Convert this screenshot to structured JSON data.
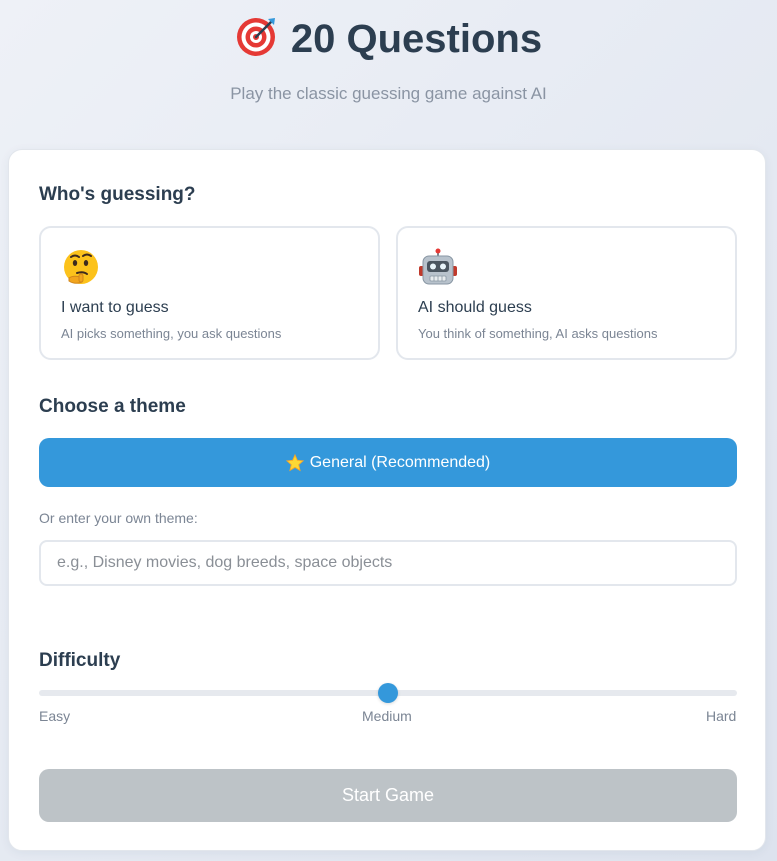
{
  "header": {
    "title": "20 Questions",
    "title_icon": "dart-target-icon",
    "subtitle": "Play the classic guessing game against AI"
  },
  "guesser": {
    "heading": "Who's guessing?",
    "options": [
      {
        "icon": "thinking-face-icon",
        "title": "I want to guess",
        "description": "AI picks something, you ask questions"
      },
      {
        "icon": "robot-icon",
        "title": "AI should guess",
        "description": "You think of something, AI asks questions"
      }
    ]
  },
  "theme": {
    "heading": "Choose a theme",
    "selected_label": "General (Recommended)",
    "selected_icon": "star-icon",
    "custom_label": "Or enter your own theme:",
    "custom_placeholder": "e.g., Disney movies, dog breeds, space objects",
    "custom_value": ""
  },
  "difficulty": {
    "heading": "Difficulty",
    "labels": [
      "Easy",
      "Medium",
      "Hard"
    ],
    "value": "Medium",
    "position_fraction": 0.5
  },
  "start": {
    "label": "Start Game",
    "enabled": false
  },
  "colors": {
    "accent": "#3498db",
    "disabled": "#bdc3c7",
    "text": "#2c3e50",
    "muted": "#7b8594"
  }
}
